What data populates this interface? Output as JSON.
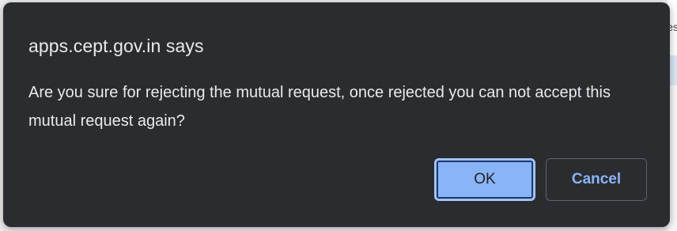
{
  "background": {
    "edge_text": "es"
  },
  "dialog": {
    "title": "apps.cept.gov.in says",
    "message": "Are you sure for rejecting the mutual request, once rejected you can not accept this mutual request again?",
    "ok_label": "OK",
    "cancel_label": "Cancel",
    "colors": {
      "dialog_bg": "#2b2c30",
      "text": "#e8eaed",
      "ok_bg": "#8ab4f8",
      "cancel_text": "#8ab4f8"
    }
  }
}
